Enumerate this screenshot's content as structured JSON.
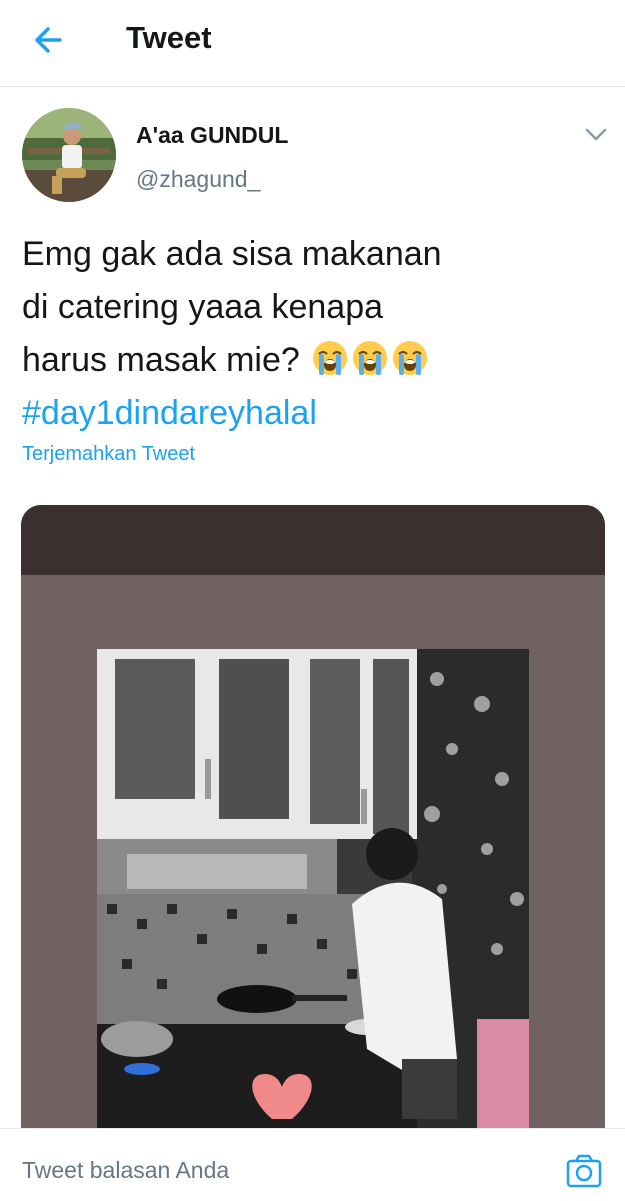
{
  "header": {
    "title": "Tweet",
    "back_icon": "arrow-left-icon"
  },
  "author": {
    "name": "A'aa GUNDUL",
    "handle": "@zhagund_",
    "avatar": "avatar-photo"
  },
  "tweet": {
    "lines": [
      "Emg gak ada sisa makanan",
      "di catering yaaa kenapa",
      "harus masak mie?"
    ],
    "emojis": [
      "loudly-crying-face-icon",
      "loudly-crying-face-icon",
      "loudly-crying-face-icon"
    ],
    "hashtag": "#day1dindareyhalal",
    "translate_label": "Terjemahkan Tweet"
  },
  "media": {
    "description_icon": "photo-kitchen-cooking"
  },
  "reply": {
    "placeholder": "Tweet balasan Anda",
    "camera_icon": "camera-icon"
  },
  "colors": {
    "accent": "#1da1f2",
    "text": "#14171a",
    "secondary": "#657786"
  }
}
